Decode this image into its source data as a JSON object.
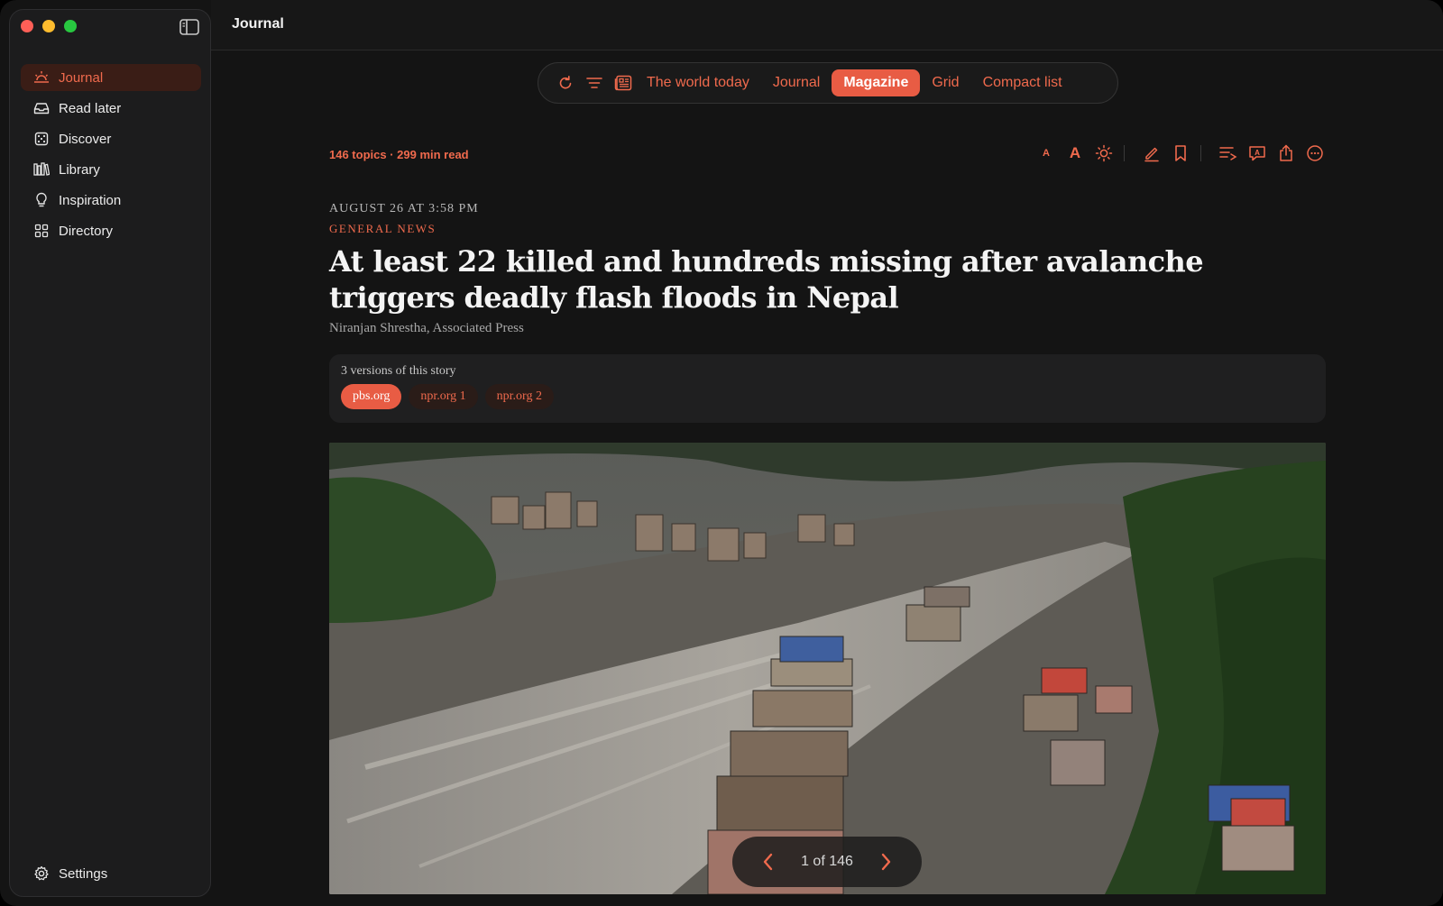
{
  "window": {
    "title": "Journal"
  },
  "sidebar": {
    "items": [
      {
        "label": "Journal",
        "icon": "sunrise-icon",
        "active": true
      },
      {
        "label": "Read later",
        "icon": "inbox-tray-icon"
      },
      {
        "label": "Discover",
        "icon": "dice-icon"
      },
      {
        "label": "Library",
        "icon": "books-icon"
      },
      {
        "label": "Inspiration",
        "icon": "lightbulb-icon"
      },
      {
        "label": "Directory",
        "icon": "grid-icon"
      }
    ],
    "settings_label": "Settings"
  },
  "viewbar": {
    "world_today": "The world today",
    "options": [
      "Journal",
      "Magazine",
      "Grid",
      "Compact list"
    ],
    "selected": "Magazine"
  },
  "article": {
    "stats": "146 topics · 299 min read",
    "date": "AUGUST 26 AT 3:58 PM",
    "category": "GENERAL NEWS",
    "headline": "At least 22 killed and hundreds missing after avalanche triggers deadly flash floods in Nepal",
    "byline": "Niranjan Shrestha, Associated Press",
    "versions_title": "3 versions of this story",
    "versions": [
      "pbs.org",
      "npr.org 1",
      "npr.org 2"
    ],
    "selected_version": "pbs.org"
  },
  "pager": {
    "label": "1 of 146",
    "current": 1,
    "total": 146
  },
  "colors": {
    "accent": "#e85c44",
    "accent_text": "#f06a4d",
    "background": "#141414",
    "sidebar": "#1c1c1d"
  }
}
